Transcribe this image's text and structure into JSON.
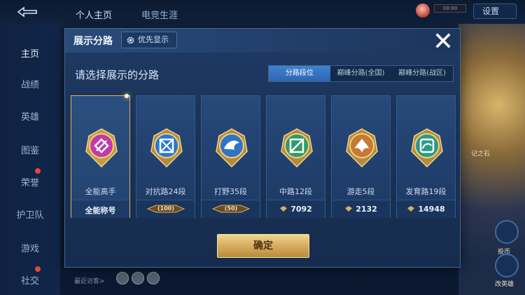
{
  "header": {
    "tabs": [
      "个人主页",
      "电竞生涯"
    ],
    "settings_label": "设置",
    "timer_text": "00:00"
  },
  "sidebar": {
    "items": [
      {
        "label": "主页",
        "active": true
      },
      {
        "label": "战绩"
      },
      {
        "label": "英雄"
      },
      {
        "label": "图鉴"
      },
      {
        "label": "荣誉"
      },
      {
        "label": "护卫队"
      },
      {
        "label": "游戏"
      },
      {
        "label": "社交"
      }
    ]
  },
  "right_panel": {
    "labels": [
      "记之石",
      "投币",
      "改英雄"
    ]
  },
  "bottom": {
    "visitor_label": "最近访客>"
  },
  "modal": {
    "title": "展示分路",
    "priority_label": "优先显示",
    "subtitle": "请选择展示的分路",
    "filter_tabs": [
      {
        "label": "分路段位",
        "active": true
      },
      {
        "label": "巅峰分路(全国)"
      },
      {
        "label": "巅峰分路(战区)"
      }
    ],
    "cards": [
      {
        "name": "全能高手",
        "footer": "全能称号",
        "selected": true,
        "emblem_color": "#c23aa8"
      },
      {
        "name": "对抗路24段",
        "rank": "100",
        "emblem_color": "#2a78d0"
      },
      {
        "name": "打野35段",
        "rank": "50",
        "emblem_color": "#2f74c8"
      },
      {
        "name": "中路12段",
        "score": "7092",
        "emblem_color": "#2f9a6a"
      },
      {
        "name": "游走5段",
        "score": "2132",
        "emblem_color": "#c27a35"
      },
      {
        "name": "发育路19段",
        "score": "14948",
        "emblem_color": "#2a9a8a"
      }
    ],
    "confirm_label": "确定"
  },
  "colors": {
    "accent_gold": "#d9b063",
    "active_tab_blue": "#3f82d0",
    "panel_blue": "#1f3a64"
  }
}
